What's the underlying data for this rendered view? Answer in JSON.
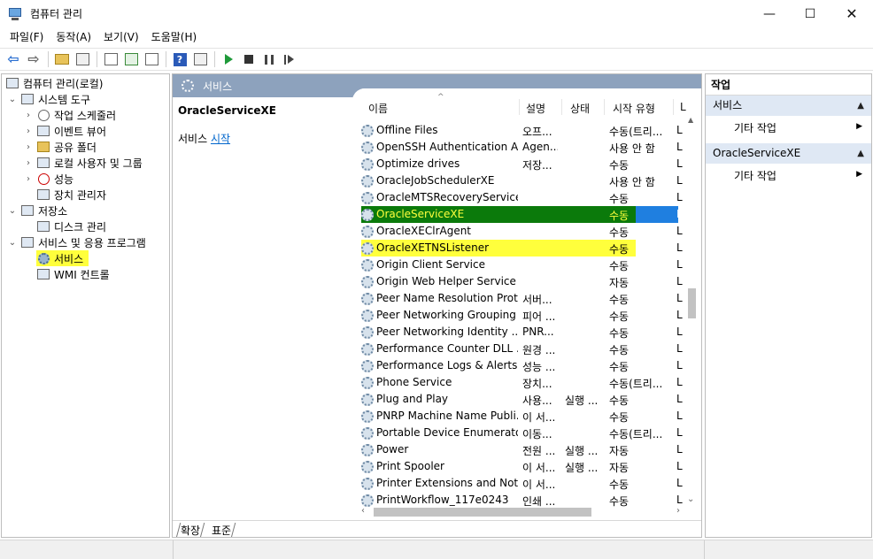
{
  "window": {
    "title": "컴퓨터 관리",
    "minimize": "—",
    "maximize": "☐",
    "close": "✕"
  },
  "menu": [
    "파일(F)",
    "동작(A)",
    "보기(V)",
    "도움말(H)"
  ],
  "toolbar": {
    "back_icon": "back-arrow-icon",
    "forward_icon": "forward-arrow-icon",
    "help_label": "?"
  },
  "tree": {
    "root": "컴퓨터 관리(로컬)",
    "system_tools": "시스템 도구",
    "task_scheduler": "작업 스케줄러",
    "event_viewer": "이벤트 뷰어",
    "shared_folders": "공유 폴더",
    "local_users": "로컬 사용자 및 그룹",
    "performance": "성능",
    "device_manager": "장치 관리자",
    "storage": "저장소",
    "disk_management": "디스크 관리",
    "services_apps": "서비스 및 응용 프로그램",
    "services": "서비스",
    "wmi": "WMI 컨트롤"
  },
  "middle": {
    "header_title": "서비스",
    "selected_service": "OracleServiceXE",
    "action_prefix": "서비스 ",
    "action_link": "시작",
    "columns": {
      "name": "이름",
      "description": "설명",
      "status": "상태",
      "startup": "시작 유형",
      "logon": "L"
    },
    "rows": [
      {
        "name": "Offline Files",
        "desc": "오프...",
        "state": "",
        "start": "수동(트리...",
        "logon": "L"
      },
      {
        "name": "OpenSSH Authentication A...",
        "desc": "Agen...",
        "state": "",
        "start": "사용 안 함",
        "logon": "L"
      },
      {
        "name": "Optimize drives",
        "desc": "저장...",
        "state": "",
        "start": "수동",
        "logon": "L"
      },
      {
        "name": "OracleJobSchedulerXE",
        "desc": "",
        "state": "",
        "start": "사용 안 함",
        "logon": "L"
      },
      {
        "name": "OracleMTSRecoveryService",
        "desc": "",
        "state": "",
        "start": "수동",
        "logon": "L"
      },
      {
        "name": "OracleServiceXE",
        "desc": "",
        "state": "",
        "start": "수동",
        "logon": "L"
      },
      {
        "name": "OracleXEClrAgent",
        "desc": "",
        "state": "",
        "start": "수동",
        "logon": "L"
      },
      {
        "name": "OracleXETNSListener",
        "desc": "",
        "state": "",
        "start": "수동",
        "logon": "L"
      },
      {
        "name": "Origin Client Service",
        "desc": "",
        "state": "",
        "start": "수동",
        "logon": "L"
      },
      {
        "name": "Origin Web Helper Service",
        "desc": "",
        "state": "",
        "start": "자동",
        "logon": "L"
      },
      {
        "name": "Peer Name Resolution Prot...",
        "desc": "서버...",
        "state": "",
        "start": "수동",
        "logon": "L"
      },
      {
        "name": "Peer Networking Grouping",
        "desc": "피어 ...",
        "state": "",
        "start": "수동",
        "logon": "L"
      },
      {
        "name": "Peer Networking Identity ...",
        "desc": "PNR...",
        "state": "",
        "start": "수동",
        "logon": "L"
      },
      {
        "name": "Performance Counter DLL ...",
        "desc": "원경 ...",
        "state": "",
        "start": "수동",
        "logon": "L"
      },
      {
        "name": "Performance Logs & Alerts",
        "desc": "성능 ...",
        "state": "",
        "start": "수동",
        "logon": "L"
      },
      {
        "name": "Phone Service",
        "desc": "장치...",
        "state": "",
        "start": "수동(트리...",
        "logon": "L"
      },
      {
        "name": "Plug and Play",
        "desc": "사용...",
        "state": "실행 ...",
        "start": "수동",
        "logon": "L"
      },
      {
        "name": "PNRP Machine Name Publi...",
        "desc": "이 서...",
        "state": "",
        "start": "수동",
        "logon": "L"
      },
      {
        "name": "Portable Device Enumerato...",
        "desc": "이동...",
        "state": "",
        "start": "수동(트리...",
        "logon": "L"
      },
      {
        "name": "Power",
        "desc": "전원 ...",
        "state": "실행 ...",
        "start": "자동",
        "logon": "L"
      },
      {
        "name": "Print Spooler",
        "desc": "이 서...",
        "state": "실행 ...",
        "start": "자동",
        "logon": "L"
      },
      {
        "name": "Printer Extensions and Noti...",
        "desc": "이 서...",
        "state": "",
        "start": "수동",
        "logon": "L"
      },
      {
        "name": "PrintWorkflow_117e0243",
        "desc": "인쇄 ...",
        "state": "",
        "start": "수동",
        "logon": "L"
      }
    ],
    "tabs": [
      "확장",
      "표준"
    ]
  },
  "actions": {
    "header": "작업",
    "section1": "서비스",
    "section1_item": "기타 작업",
    "section2": "OracleServiceXE",
    "section2_item": "기타 작업"
  },
  "colors": {
    "header_blue": "#8da2bd",
    "selection_green": "#0b7a0b",
    "selection_blue": "#1f7fe0",
    "highlight_yellow": "#ffff3c",
    "action_section_bg": "#dfe8f4"
  }
}
